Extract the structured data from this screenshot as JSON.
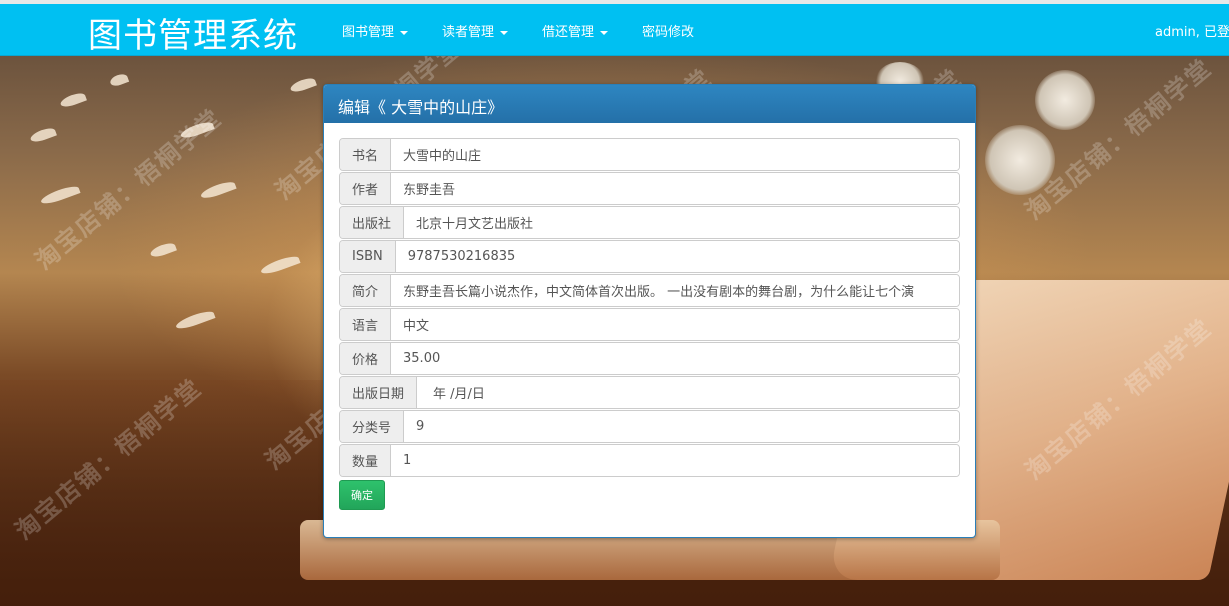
{
  "navbar": {
    "brand": "图书管理系统",
    "items": [
      {
        "label": "图书管理",
        "dropdown": true
      },
      {
        "label": "读者管理",
        "dropdown": true
      },
      {
        "label": "借还管理",
        "dropdown": true
      },
      {
        "label": "密码修改",
        "dropdown": false
      }
    ],
    "user_text": "admin, 已登录",
    "color": "#00c0f2"
  },
  "panel": {
    "title": "编辑《 大雪中的山庄》",
    "header_color": "#2e86c1",
    "fields": [
      {
        "label": "书名",
        "value": "大雪中的山庄"
      },
      {
        "label": "作者",
        "value": "东野圭吾"
      },
      {
        "label": "出版社",
        "value": "北京十月文艺出版社"
      },
      {
        "label": "ISBN",
        "value": "9787530216835"
      },
      {
        "label": "简介",
        "value": "东野圭吾长篇小说杰作，中文简体首次出版。 一出没有剧本的舞台剧，为什么能让七个演"
      },
      {
        "label": "语言",
        "value": "中文"
      },
      {
        "label": "价格",
        "value": "35.00"
      },
      {
        "label": "出版日期",
        "value": "年 /月/日"
      },
      {
        "label": "分类号",
        "value": "9"
      },
      {
        "label": "数量",
        "value": "1"
      }
    ],
    "submit_label": "确定",
    "submit_color": "#28b463"
  },
  "watermarks": [
    "淘宝店铺：梧桐学堂",
    "淘宝店铺：梧桐学堂"
  ]
}
